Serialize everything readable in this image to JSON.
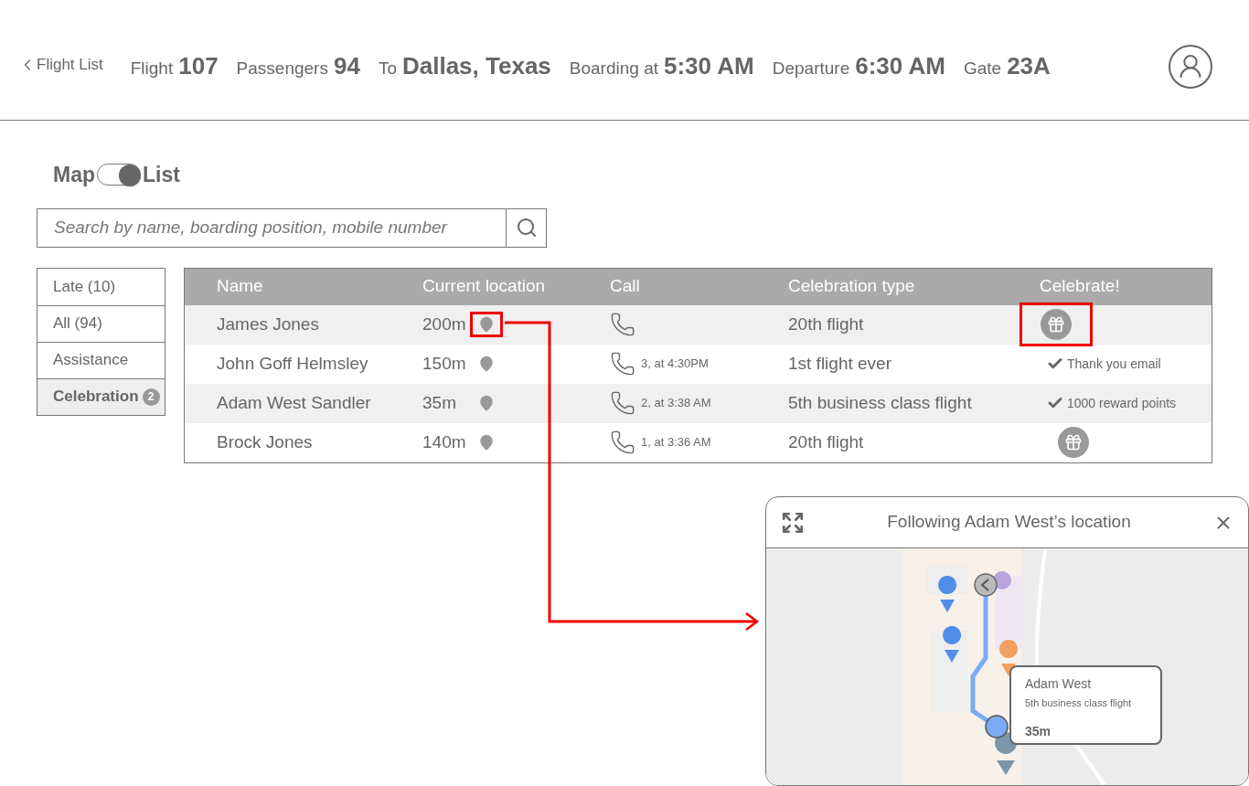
{
  "back_link": "Flight List",
  "flight_info": [
    {
      "label": "Flight",
      "value": "107"
    },
    {
      "label": "Passengers",
      "value": "94"
    },
    {
      "label": "To",
      "value": "Dallas, Texas"
    },
    {
      "label": "Boarding at",
      "value": "5:30 AM"
    },
    {
      "label": "Departure",
      "value": "6:30 AM"
    },
    {
      "label": "Gate",
      "value": "23A"
    }
  ],
  "view_toggle": {
    "left": "Map",
    "right": "List",
    "on": true
  },
  "search": {
    "placeholder": "Search by name, boarding position, mobile number"
  },
  "filters": [
    {
      "label": "Late (10)",
      "selected": false
    },
    {
      "label": "All (94)",
      "selected": false
    },
    {
      "label": "Assistance",
      "selected": false
    },
    {
      "label": "Celebration",
      "badge": "2",
      "selected": true
    }
  ],
  "table": {
    "columns": [
      "Name",
      "Current location",
      "Call",
      "Celebration type",
      "Celebrate!"
    ],
    "rows": [
      {
        "name": "James Jones",
        "location": "200m",
        "call_note": "",
        "celebration_type": "20th flight",
        "celebrate": {
          "kind": "gift"
        },
        "highlighted": true
      },
      {
        "name": "John Goff Helmsley",
        "location": "150m",
        "call_note": "3, at 4:30PM",
        "celebration_type": "1st flight ever",
        "celebrate": {
          "kind": "done",
          "text": "Thank you email"
        },
        "highlighted": false
      },
      {
        "name": "Adam West Sandler",
        "location": "35m",
        "call_note": "2, at 3:38 AM",
        "celebration_type": "5th business class flight",
        "celebrate": {
          "kind": "done",
          "text": "1000 reward points"
        },
        "highlighted": false
      },
      {
        "name": "Brock Jones",
        "location": "140m",
        "call_note": "1, at 3:36 AM",
        "celebration_type": "20th flight",
        "celebrate": {
          "kind": "gift"
        },
        "highlighted": false
      }
    ]
  },
  "map_panel": {
    "title": "Following Adam West’s location",
    "callout": {
      "name": "Adam West",
      "detail": "5th business class flight",
      "distance": "35m"
    }
  }
}
